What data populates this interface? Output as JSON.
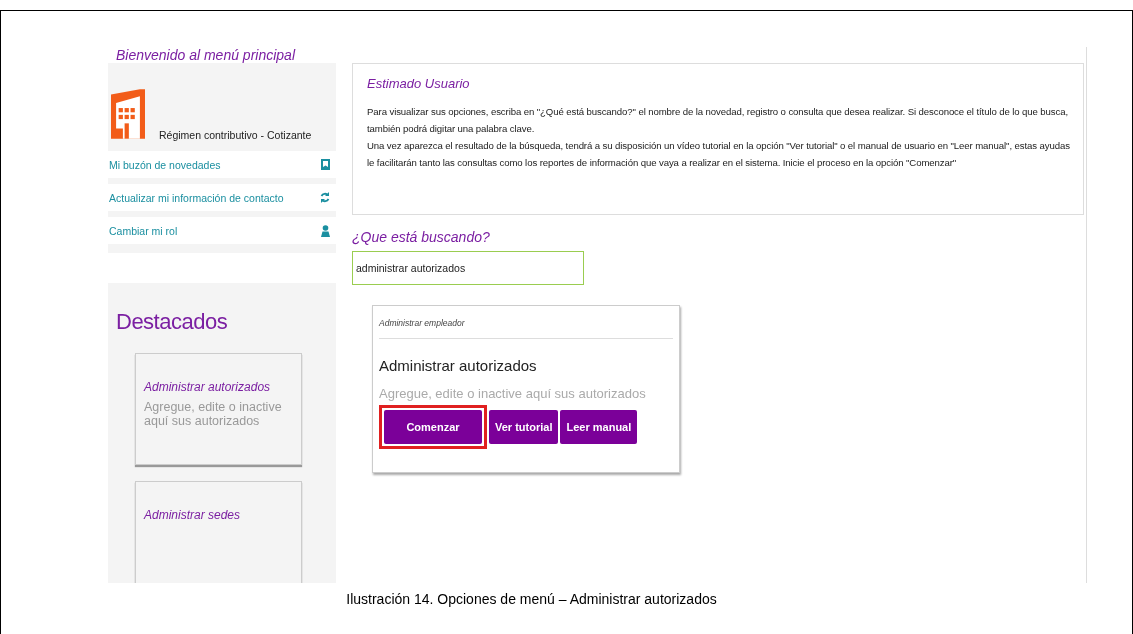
{
  "page_heading": "Bienvenido al menú principal",
  "profile": {
    "regime": "Régimen contributivo - Cotizante"
  },
  "sidebar": {
    "items": [
      {
        "label": "Mi buzón de novedades"
      },
      {
        "label": "Actualizar mi información de contacto"
      },
      {
        "label": "Cambiar mi rol"
      }
    ]
  },
  "featured": {
    "title": "Destacados",
    "cards": [
      {
        "title": "Administrar autorizados",
        "description": "Agregue, edite o inactive aquí sus autorizados"
      },
      {
        "title": "Administrar sedes"
      }
    ]
  },
  "notice": {
    "title": "Estimado Usuario",
    "paragraphs": [
      "Para visualizar sus opciones, escriba en \"¿Qué está buscando?\" el nombre de la novedad, registro o consulta que desea realizar. Si desconoce el título de lo que busca, también podrá digitar una palabra clave.",
      "Una vez aparezca el resultado de la búsqueda, tendrá a su disposición un vídeo tutorial en la opción \"Ver tutorial\" o el manual de usuario en \"Leer manual\", estas ayudas le facilitarán tanto las consultas como los reportes de información que vaya a realizar en el sistema. Inicie el proceso en la opción \"Comenzar\""
    ]
  },
  "search": {
    "label": "¿Que está buscando?",
    "value": "administrar autorizados"
  },
  "result": {
    "category": "Administrar empleador",
    "title": "Administrar autorizados",
    "description": "Agregue, edite o inactive aquí sus autorizados",
    "buttons": [
      {
        "label": "Comenzar",
        "highlighted": true
      },
      {
        "label": "Ver tutorial",
        "highlighted": false
      },
      {
        "label": "Leer manual",
        "highlighted": false
      }
    ]
  },
  "caption": "Ilustración 14. Opciones de menú – Administrar autorizados"
}
